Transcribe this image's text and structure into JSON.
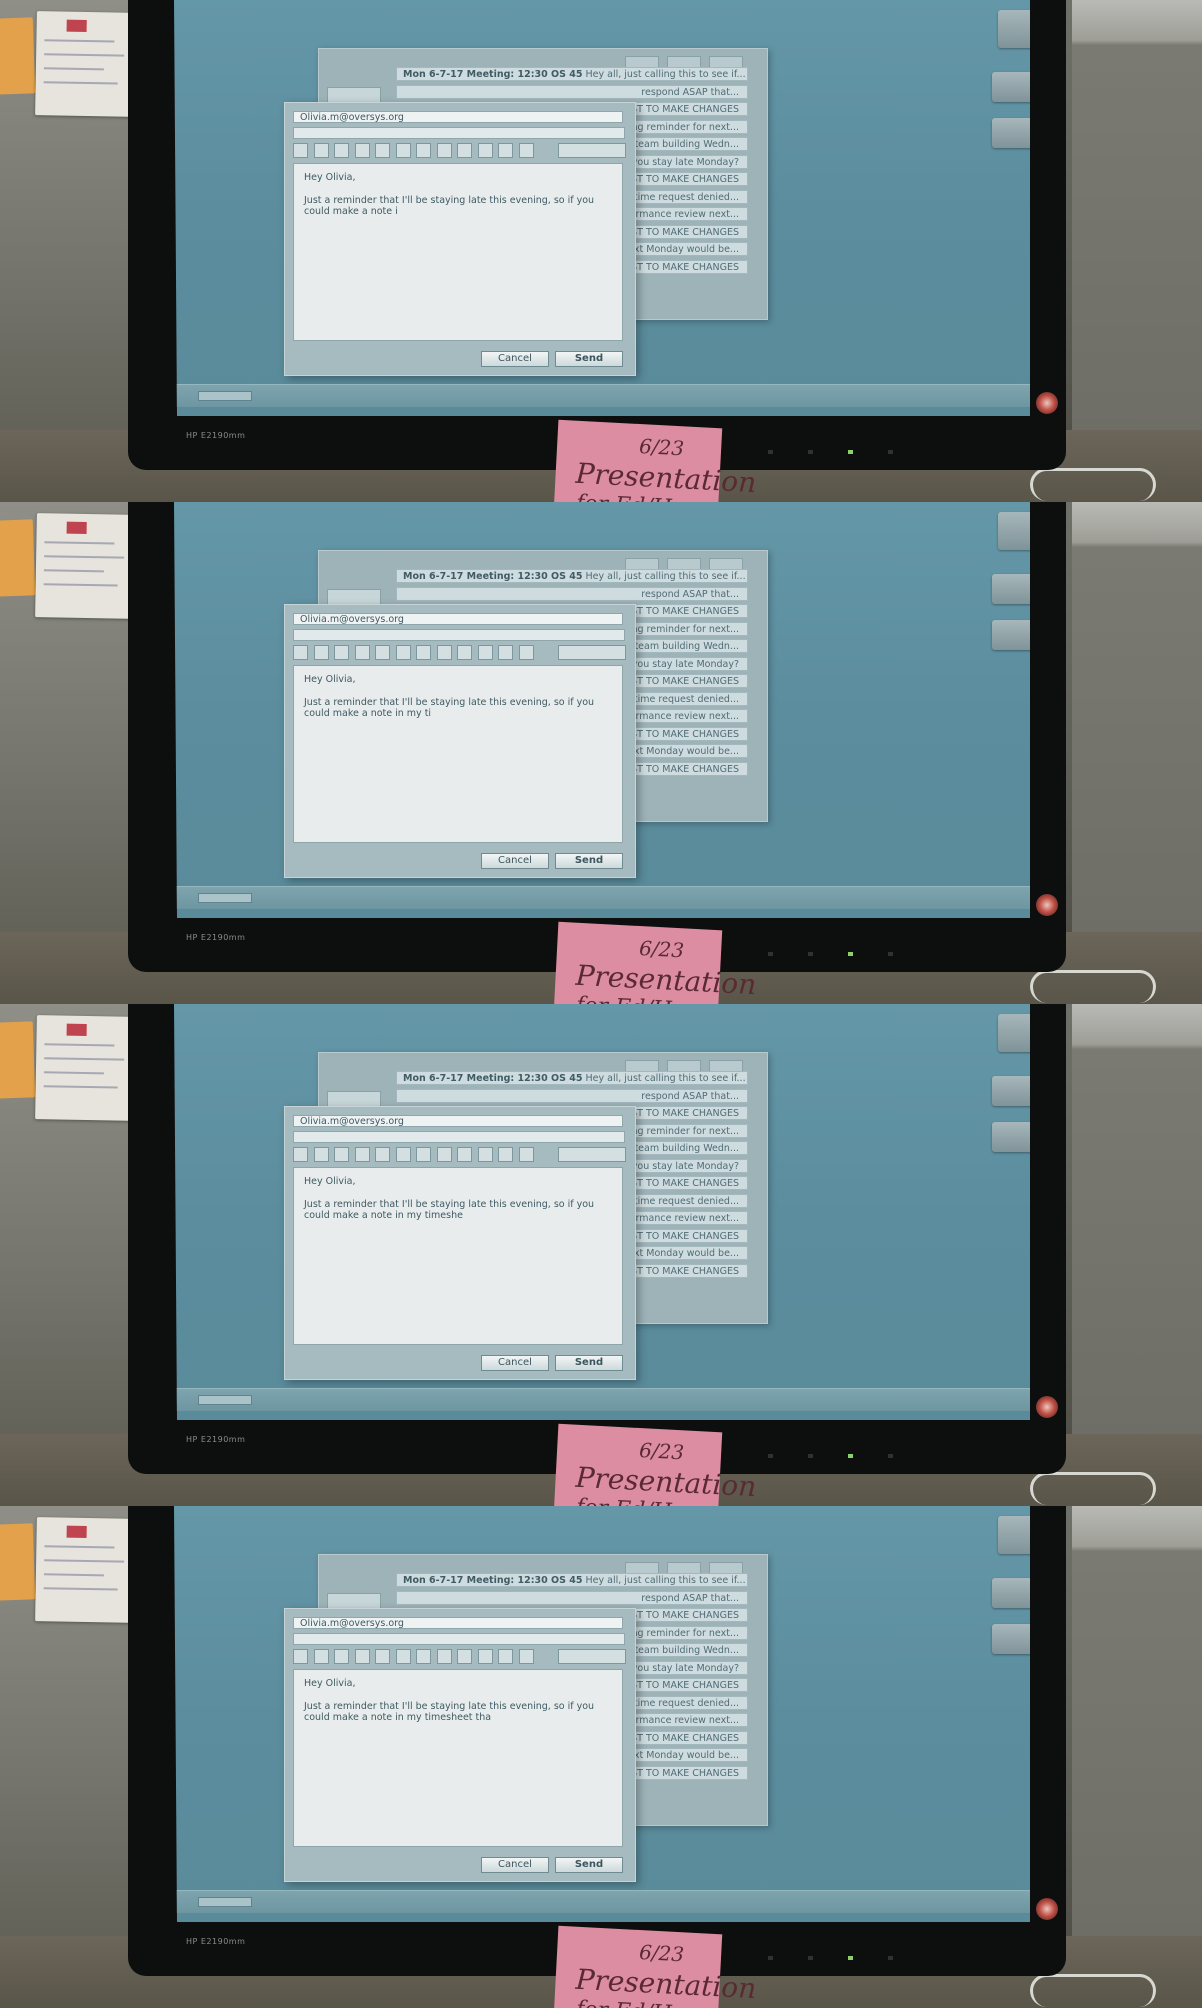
{
  "compose": {
    "to": "Olivia.m@oversys.org",
    "greeting": "Hey Olivia,",
    "cancel_label": "Cancel",
    "send_label": "Send",
    "frames": [
      "Just a reminder that I'll be staying late this evening, so if you could make a note i",
      "Just a reminder that I'll be staying late this evening, so if you could make a note in my ti",
      "Just a reminder that I'll be staying late this evening, so if you could make a note in my timeshe",
      "Just a reminder that I'll be staying late this evening, so if you could make a note in my timesheet tha"
    ]
  },
  "inbox": {
    "rows": [
      {
        "subject": "Mon 6-7-17 Meeting: 12:30 OS 45",
        "preview": "Hey all, just calling this to see if..."
      },
      {
        "subject": "",
        "preview": "respond ASAP that..."
      },
      {
        "subject": "",
        "preview": "EST TO MAKE CHANGES"
      },
      {
        "subject": "",
        "preview": "ng reminder for next..."
      },
      {
        "subject": "",
        "preview": "for team building Wedn..."
      },
      {
        "subject": "",
        "preview": "n you stay late Monday?"
      },
      {
        "subject": "",
        "preview": "EST TO MAKE CHANGES"
      },
      {
        "subject": "",
        "preview": "on time request denied..."
      },
      {
        "subject": "",
        "preview": "rformance review next..."
      },
      {
        "subject": "",
        "preview": "EST TO MAKE CHANGES"
      },
      {
        "subject": "",
        "preview": "xt Monday would be..."
      },
      {
        "subject": "",
        "preview": "EST TO MAKE CHANGES"
      }
    ]
  },
  "sticky_note": {
    "date": "6/23",
    "line1": "Presentation",
    "line2": "for Ed/Hoe"
  },
  "monitor": {
    "brand": "HP E2190mm"
  },
  "colors": {
    "desktop": "#5b8d9f",
    "window": "#a5bbc0",
    "sticky_pink": "#dc8da1"
  },
  "icons": [
    "window-icon",
    "folder-icon",
    "folder-icon"
  ]
}
